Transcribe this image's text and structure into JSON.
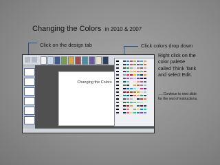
{
  "slide": {
    "title": "Changing the Colors",
    "title_suffix": "in  2010 & 2007"
  },
  "captions": {
    "design_tab": "Click on the design tab",
    "colors_dropdown": "Click colors drop down"
  },
  "note": {
    "text": "Right click on the color palette called Think Tank and select Edit.",
    "continue_text": "…..Continue to next slide for the rest of instructions."
  },
  "screenshot": {
    "slide_title": "Changing the Colors"
  },
  "colors": {
    "background": "#8a8a8a",
    "bracket": "#2f4f8f"
  }
}
